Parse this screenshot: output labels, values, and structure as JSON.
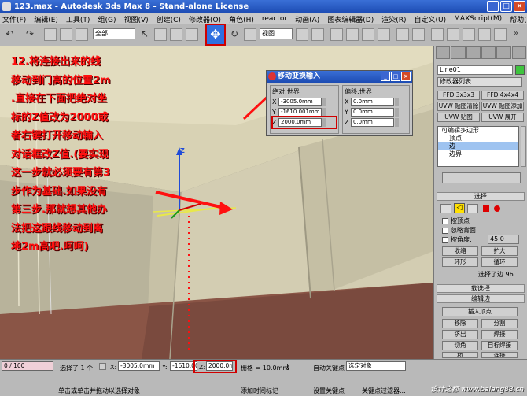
{
  "window": {
    "title": "123.max - Autodesk 3ds Max 8 - Stand-alone License",
    "buttons": [
      "_",
      "□",
      "×"
    ]
  },
  "menu": [
    "文件(F)",
    "编辑(E)",
    "工具(T)",
    "组(G)",
    "视图(V)",
    "创建(C)",
    "修改器(O)",
    "角色(H)",
    "reactor",
    "动画(A)",
    "图表编辑器(D)",
    "渲染(R)",
    "自定义(U)",
    "MAXScript(M)",
    "帮助(H)"
  ],
  "toolbar": {
    "selection_filter": "全部",
    "ref_coord": "视图"
  },
  "annotation": "12.将连接出来的线\n移动到门高的位置2m\n.直接在下面把绝对坐\n标的Z值改为2000或\n者右键打开移动输入\n对话框改Z值.(要实现\n这一步就必须要有第3\n步作为基础.如果没有\n第三步.那就想其他办\n法把这跟线移动到离\n地2m高吧.呵呵)",
  "axis_label": "Z",
  "dialog": {
    "title": "移动变换输入",
    "absolute": {
      "label": "绝对:世界",
      "x": "-3005.0mm",
      "y": "-1610.001mm",
      "z": "2000.0mm"
    },
    "offset": {
      "label": "偏移:世界",
      "x": "0.0mm",
      "y": "0.0mm",
      "z": "0.0mm"
    }
  },
  "right_panel": {
    "object_name": "Line01",
    "color": "#3ec43e",
    "modifier_list": "修改器列表",
    "buttons": [
      "FFD 3x3x3",
      "FFD 4x4x4",
      "UVW 贴图清除",
      "UVW 贴图添加",
      "UVW 贴图",
      "UVW 展开"
    ],
    "stack": [
      "可编辑多边形",
      "顶点",
      "边",
      "边界"
    ],
    "stack_selected": 2,
    "selection_title": "选择",
    "by_vertex": "按顶点",
    "ignore_backfacing": "忽略背面",
    "by_angle": "按角度:",
    "angle_value": "45.0",
    "shrink": "收缩",
    "grow": "扩大",
    "ring": "环形",
    "loop": "循环",
    "selected_info": "选择了边 96",
    "soft_selection": "软选择",
    "edit_edges": "编辑边",
    "insert_vertex": "插入顶点",
    "remove": "移除",
    "split": "分割",
    "extrude": "挤出",
    "weld": "焊接",
    "chamfer": "切角",
    "target_weld": "目标焊接",
    "bridge": "桥",
    "connect": "连接"
  },
  "status": {
    "frame": "0 / 100",
    "selected": "选择了 1 个",
    "x_label": "X:",
    "x": "-3005.0mm",
    "y_label": "Y:",
    "y": "-1610.001",
    "z_label": "Z:",
    "z": "2000.0mm",
    "grid": "栅格 = 10.0mm",
    "prompt": "单击或单击并拖动以选择对象",
    "add_time_tag": "添加时间标记",
    "auto_key": "自动关键点",
    "selected_objects": "选定对象",
    "set_key": "设置关键点",
    "key_filters": "关键点过滤器...",
    "watermark": "设计之都 www.balang88.cn"
  },
  "colors": {
    "highlight": "#d00000",
    "annotation": "#ff1010",
    "title_blue": "#1c4bb3"
  }
}
